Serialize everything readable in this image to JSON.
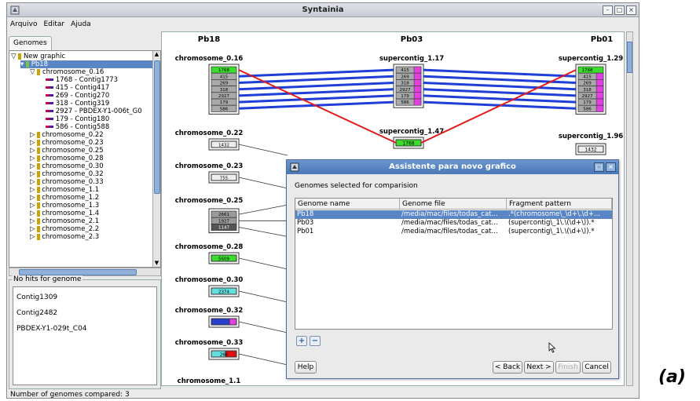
{
  "window": {
    "title": "Syntainia"
  },
  "menu": [
    "Arquivo",
    "Editar",
    "Ajuda"
  ],
  "tab": {
    "label": "Genomes"
  },
  "tree": {
    "root": "New graphic",
    "selected": "Pb18",
    "expanded_chromosome": "chromosome_0.16",
    "contigs": [
      "1768 - Contig1773",
      "415 - Contig417",
      "269 - Contig270",
      "318 - Contig319",
      "2927 - PBDEX-Y1-006t_G0",
      "179 - Contig180",
      "586 - Contig588"
    ],
    "chromosomes": [
      "chromosome_0.22",
      "chromosome_0.23",
      "chromosome_0.25",
      "chromosome_0.28",
      "chromosome_0.30",
      "chromosome_0.32",
      "chromosome_0.33",
      "chromosome_1.1",
      "chromosome_1.2",
      "chromosome_1.3",
      "chromosome_1.4",
      "chromosome_2.1",
      "chromosome_2.2",
      "chromosome_2.3"
    ]
  },
  "nohits": {
    "title": "No hits for genome",
    "items": [
      "Contig1309",
      "Contig2482",
      "PBDEX-Y1-029t_C04"
    ]
  },
  "status": "Number of genomes compared: 3",
  "graph": {
    "headers": [
      "Pb18",
      "Pb03",
      "Pb01"
    ],
    "left_labels": [
      "chromosome_0.16",
      "chromosome_0.22",
      "chromosome_0.23",
      "chromosome_0.25",
      "chromosome_0.28",
      "chromosome_0.30",
      "chromosome_0.32",
      "chromosome_0.33",
      "chromosome_1.1"
    ],
    "left_main_values": [
      "1768",
      "415",
      "269",
      "318",
      "2927",
      "179",
      "586"
    ],
    "mid_labels": [
      "supercontig_1.17",
      "supercontig_1.47"
    ],
    "mid_main_values": [
      "415",
      "269",
      "318",
      "2927",
      "179",
      "586"
    ],
    "mid_small_value": "1768",
    "right_labels": [
      "supercontig_1.29",
      "supercontig_1.96"
    ],
    "right_main_values": [
      "1768",
      "415",
      "269",
      "318",
      "2927",
      "179",
      "586"
    ],
    "right_small_value": "1432",
    "single_values": [
      "1432",
      "755",
      "5609",
      "2374",
      "",
      "266"
    ],
    "stack_025": [
      "2661",
      "1927",
      "1147"
    ],
    "colors": {
      "green": "#3bdc2c",
      "magenta": "#e040e0",
      "gray": "#a9a9a9",
      "blue_link": "#1d3fd6",
      "red_link": "#e01b1b",
      "cyan": "#62e0e0",
      "dark": "#555555",
      "red": "#e01010"
    }
  },
  "dialog": {
    "title": "Assistente para novo grafico",
    "label": "Genomes selected for comparision",
    "columns": [
      "Genome name",
      "Genome file",
      "Fragment pattern"
    ],
    "rows": [
      [
        "Pb18",
        "/media/mac/files/todas_cat...",
        ".*(chromosome\\_\\d+\\.\\d+..."
      ],
      [
        "Pb03",
        "/media/mac/files/todas_cat...",
        "(supercontig\\_1\\.\\(\\d+\\)).*"
      ],
      [
        "Pb01",
        "/media/mac/files/todas_cat...",
        "(supercontig\\_1\\.\\(\\d+\\)).*"
      ]
    ],
    "buttons": {
      "help": "Help",
      "back": "< Back",
      "next": "Next >",
      "finish": "Finish",
      "cancel": "Cancel"
    }
  },
  "figure_label": "(a)"
}
